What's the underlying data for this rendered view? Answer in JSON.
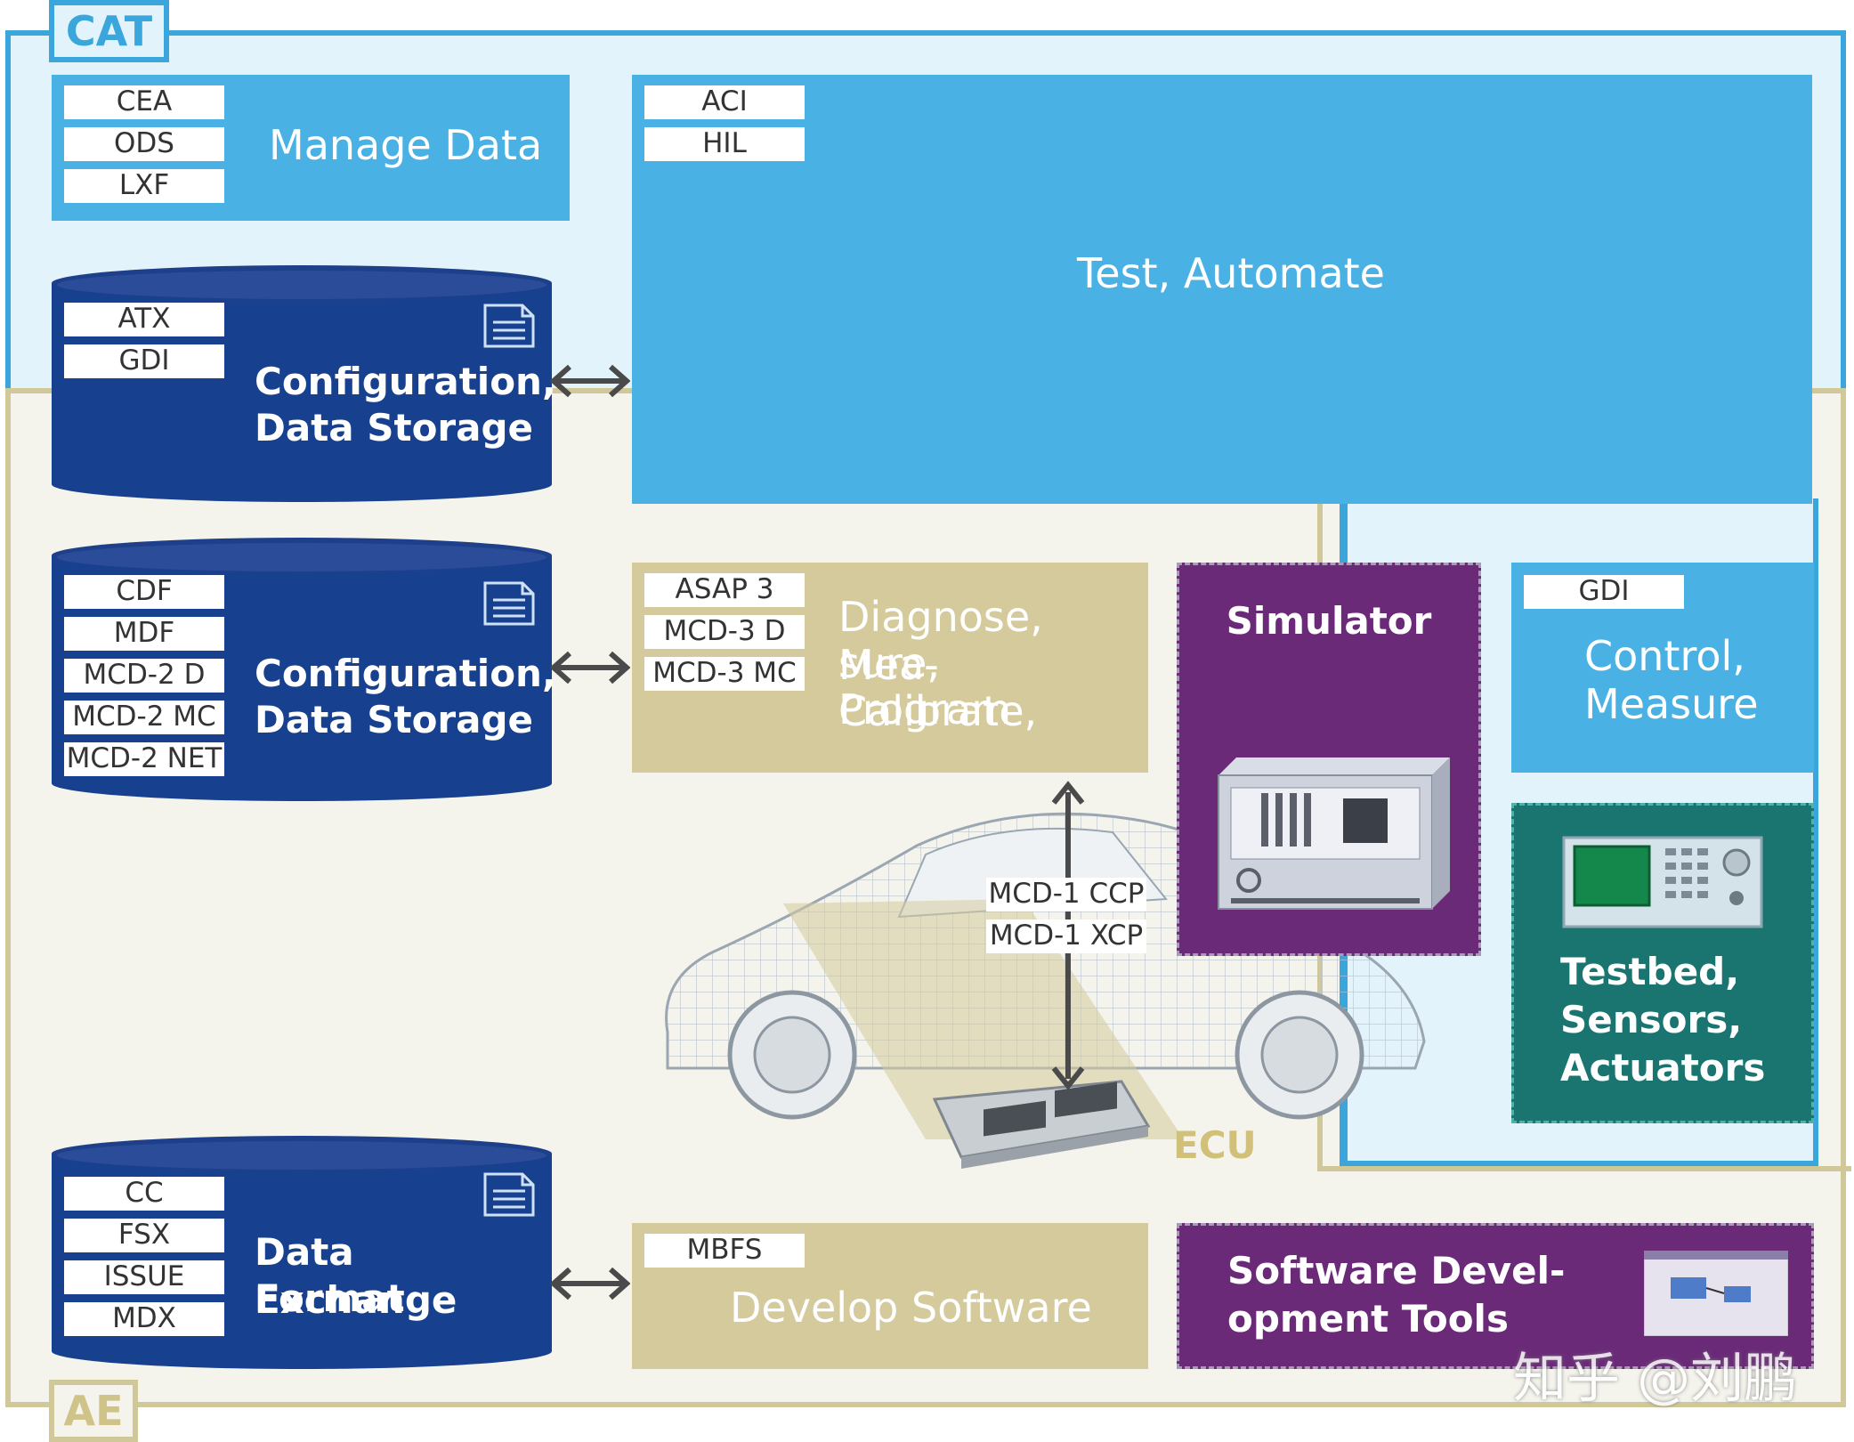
{
  "frames": {
    "cat": "CAT",
    "ae": "AE"
  },
  "manage_data": {
    "labels": [
      "CEA",
      "ODS",
      "LXF"
    ],
    "title": "Manage Data"
  },
  "test_automate": {
    "labels": [
      "ACI",
      "HIL"
    ],
    "title": "Test, Automate"
  },
  "config_storage_1": {
    "labels": [
      "ATX",
      "GDI"
    ],
    "title_line1": "Configuration,",
    "title_line2": "Data Storage"
  },
  "config_storage_2": {
    "labels": [
      "CDF",
      "MDF",
      "MCD-2 D",
      "MCD-2 MC",
      "MCD-2 NET"
    ],
    "title_line1": "Configuration,",
    "title_line2": "Data Storage"
  },
  "diagnose": {
    "labels": [
      "ASAP 3",
      "MCD-3 D",
      "MCD-3 MC"
    ],
    "title_line1": "Diagnose, Mea-",
    "title_line2": "sure, Calibrate,",
    "title_line3": "Program"
  },
  "simulator": {
    "title": "Simulator"
  },
  "control_measure": {
    "labels": [
      "GDI"
    ],
    "title_line1": "Control,",
    "title_line2": "Measure"
  },
  "testbed": {
    "title_line1": "Testbed,",
    "title_line2": "Sensors,",
    "title_line3": "Actuators"
  },
  "ecu": {
    "labels": [
      "MCD-1 CCP",
      "MCD-1 XCP"
    ],
    "title": "ECU"
  },
  "data_exchange": {
    "labels": [
      "CC",
      "FSX",
      "ISSUE",
      "MDX"
    ],
    "title_line1": "Data Exchange",
    "title_line2": "Format"
  },
  "develop_software": {
    "labels": [
      "MBFS"
    ],
    "title": "Develop Software"
  },
  "sw_tools": {
    "title_line1": "Software Devel-",
    "title_line2": "opment Tools"
  },
  "watermark": "知乎 @刘鹏",
  "colors": {
    "cat_blue": "#3aa6dc",
    "light_blue_box": "#4ab1e4",
    "db_navy": "#17408f",
    "khaki": "#d5ca9c",
    "purple": "#6a2a78",
    "teal": "#1a7570",
    "ecu_text": "#d1c07a"
  }
}
